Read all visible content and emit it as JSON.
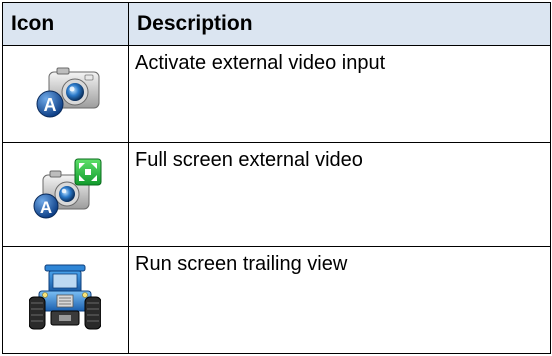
{
  "table": {
    "header": {
      "icon_label": "Icon",
      "description_label": "Description"
    },
    "rows": [
      {
        "icon": "camera-a-icon",
        "description": "Activate external video input"
      },
      {
        "icon": "camera-fullscreen-icon",
        "description": "Full screen external video"
      },
      {
        "icon": "tractor-icon",
        "description": "Run screen trailing view"
      }
    ]
  },
  "colors": {
    "header_background": "#dbe5f1",
    "border": "#000000",
    "badge_blue": "#1d5fae",
    "fullscreen_green": "#22b14c",
    "tractor_blue": "#2f86d6"
  }
}
